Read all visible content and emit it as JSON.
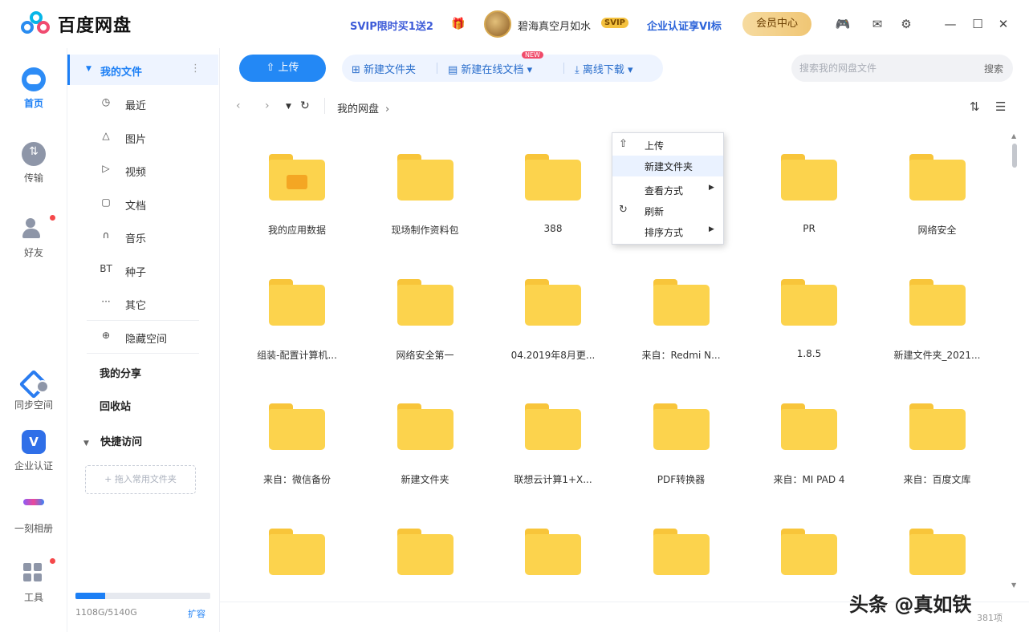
{
  "app": {
    "title": "百度网盘"
  },
  "header": {
    "svip_promo": "SVIP限时买1送2",
    "username": "碧海真空月如水",
    "vip_level": "SVIP",
    "enterprise_promo": "企业认证享VI标",
    "member_center": "会员中心"
  },
  "leftnav": {
    "home": "首页",
    "transfer": "传输",
    "friends": "好友",
    "sync": "同步空间",
    "enterprise": "企业认证",
    "album": "一刻相册",
    "tools": "工具"
  },
  "sidebar": {
    "my_files": "我的文件",
    "items": [
      {
        "label": "最近",
        "icon": "clock-icon",
        "glyph": "◷"
      },
      {
        "label": "图片",
        "icon": "image-icon",
        "glyph": "△"
      },
      {
        "label": "视频",
        "icon": "video-icon",
        "glyph": "▷"
      },
      {
        "label": "文档",
        "icon": "document-icon",
        "glyph": "▢"
      },
      {
        "label": "音乐",
        "icon": "music-icon",
        "glyph": "∩"
      },
      {
        "label": "种子",
        "icon": "torrent-icon",
        "glyph": "BT"
      },
      {
        "label": "其它",
        "icon": "more-icon",
        "glyph": "···"
      },
      {
        "label": "隐藏空间",
        "icon": "lock-icon",
        "glyph": "⊕"
      }
    ],
    "my_share": "我的分享",
    "recycle": "回收站",
    "quick_access": "快捷访问",
    "drop_hint": "+ 拖入常用文件夹",
    "storage_used": "1108G/5140G",
    "storage_fraction": 0.22,
    "expand": "扩容"
  },
  "toolbar": {
    "upload": "上传",
    "new_folder": "新建文件夹",
    "new_online_doc": "新建在线文档",
    "new_badge": "NEW",
    "offline_download": "离线下载",
    "search_placeholder": "搜索我的网盘文件",
    "search_button": "搜索"
  },
  "path": {
    "root": "我的网盘"
  },
  "files": [
    {
      "name": "我的应用数据",
      "special": true
    },
    {
      "name": "现场制作资料包"
    },
    {
      "name": "388"
    },
    {
      "name": ""
    },
    {
      "name": "PR"
    },
    {
      "name": "网络安全"
    },
    {
      "name": "组装-配置计算机..."
    },
    {
      "name": "网络安全第一"
    },
    {
      "name": "04.2019年8月更..."
    },
    {
      "name": "来自：Redmi N..."
    },
    {
      "name": "1.8.5"
    },
    {
      "name": "新建文件夹_2021..."
    },
    {
      "name": "来自：微信备份"
    },
    {
      "name": "新建文件夹"
    },
    {
      "name": "联想云计算1+X..."
    },
    {
      "name": "PDF转换器"
    },
    {
      "name": "来自：MI PAD 4"
    },
    {
      "name": "来自：百度文库"
    },
    {
      "name": ""
    },
    {
      "name": ""
    },
    {
      "name": ""
    },
    {
      "name": ""
    },
    {
      "name": ""
    },
    {
      "name": ""
    }
  ],
  "context_menu": {
    "upload": "上传",
    "new_folder": "新建文件夹",
    "view_mode": "查看方式",
    "refresh": "刷新",
    "sort_by": "排序方式"
  },
  "status": {
    "count": "381项"
  },
  "watermark": "头条 @真如铁"
}
